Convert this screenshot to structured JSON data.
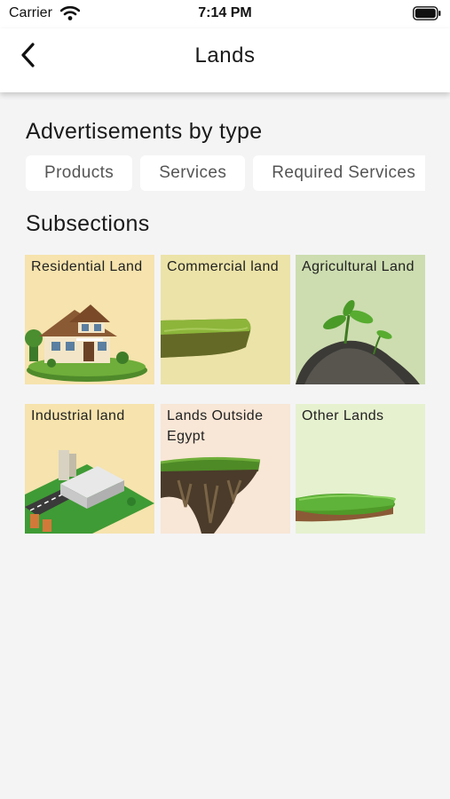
{
  "status_bar": {
    "carrier": "Carrier",
    "time": "7:14 PM"
  },
  "nav": {
    "title": "Lands",
    "back_icon": "chevron-left-icon"
  },
  "ad_types": {
    "heading": "Advertisements by type",
    "chips": [
      "Products",
      "Services",
      "Required Services"
    ]
  },
  "subsections": {
    "heading": "Subsections",
    "tiles": [
      {
        "label": "Residential Land",
        "bg": "#f6e3ad"
      },
      {
        "label": "Commercial land",
        "bg": "#ece3a8"
      },
      {
        "label": "Agricultural Land",
        "bg": "#cdddb0"
      },
      {
        "label": "Industrial land",
        "bg": "#f6e3ad"
      },
      {
        "label": "Lands Outside Egypt",
        "bg": "#f8e6d6"
      },
      {
        "label": "Other Lands",
        "bg": "#e6f1cf"
      }
    ]
  }
}
